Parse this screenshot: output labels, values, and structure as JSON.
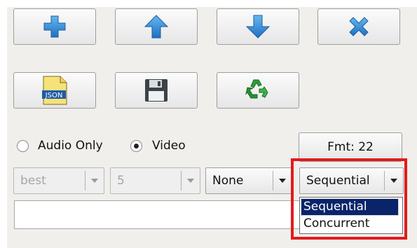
{
  "toolbar_row1": {
    "add": {
      "icon": "plus-icon"
    },
    "up": {
      "icon": "arrow-up-icon"
    },
    "down": {
      "icon": "arrow-down-icon"
    },
    "remove": {
      "icon": "x-icon"
    }
  },
  "toolbar_row2": {
    "json": {
      "icon": "json-file-icon",
      "badge": "JSON"
    },
    "save": {
      "icon": "floppy-disk-icon"
    },
    "recycle": {
      "icon": "recycle-icon"
    }
  },
  "mode": {
    "audio_only_label": "Audio Only",
    "video_label": "Video",
    "selected": "Video"
  },
  "format_button_label": "Fmt: 22",
  "combos": {
    "quality": {
      "value": "best",
      "enabled": false
    },
    "count": {
      "value": "5",
      "enabled": false
    },
    "subtitle": {
      "value": "None",
      "enabled": true
    },
    "download_mode": {
      "value": "Sequential",
      "enabled": true
    }
  },
  "download_mode_options": [
    "Sequential",
    "Concurrent"
  ],
  "url_input": {
    "value": ""
  },
  "colors": {
    "accent_blue": "#3d8fd6",
    "highlight_red": "#e21b1b",
    "selection_navy": "#0a246a"
  }
}
